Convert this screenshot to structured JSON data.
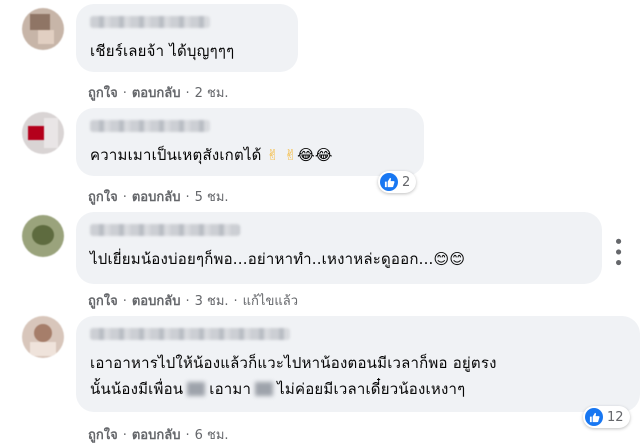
{
  "comments": [
    {
      "text": "เชียร์เลยจ้า ได้บุญๆๆๆ",
      "actions": {
        "like": "ถูกใจ",
        "reply": "ตอบกลับ",
        "time": "2 ชม."
      }
    },
    {
      "text": "ความเมาเป็นเหตุสังเกตได้",
      "emojis": [
        "✌",
        "✌",
        "😂",
        "😂"
      ],
      "actions": {
        "like": "ถูกใจ",
        "reply": "ตอบกลับ",
        "time": "5 ชม."
      },
      "reaction_count": "2"
    },
    {
      "text": "ไปเยี่ยมน้องบ่อยๆก็พอ...อย่าหาทำ..เหงาหล่ะดูออก...",
      "emojis": [
        "😊",
        "😊"
      ],
      "actions": {
        "like": "ถูกใจ",
        "reply": "ตอบกลับ",
        "time": "3 ชม.",
        "edited": "แก้ไขแล้ว"
      }
    },
    {
      "line1": "เอาอาหารไปให้น้องแล้วก็แวะไปหาน้องตอนมีเวลาก็พอ อยู่ตรง",
      "line2_a": "นั้นน้องมีเพื่อน",
      "line2_b": "เอามา",
      "line2_c": "ไม่ค่อยมีเวลาเดี๋ยวน้องเหงาๆ",
      "actions": {
        "like": "ถูกใจ",
        "reply": "ตอบกลับ",
        "time": "6 ชม."
      },
      "reaction_count": "12"
    }
  ],
  "icons": {
    "like": "thumbs-up-icon",
    "more": "more-options-icon"
  },
  "colors": {
    "bubble": "#f0f2f5",
    "meta": "#65676b",
    "like_blue": "#1877f2",
    "emoji_hand": "#f5b836",
    "emoji_face": "#f7c034"
  }
}
